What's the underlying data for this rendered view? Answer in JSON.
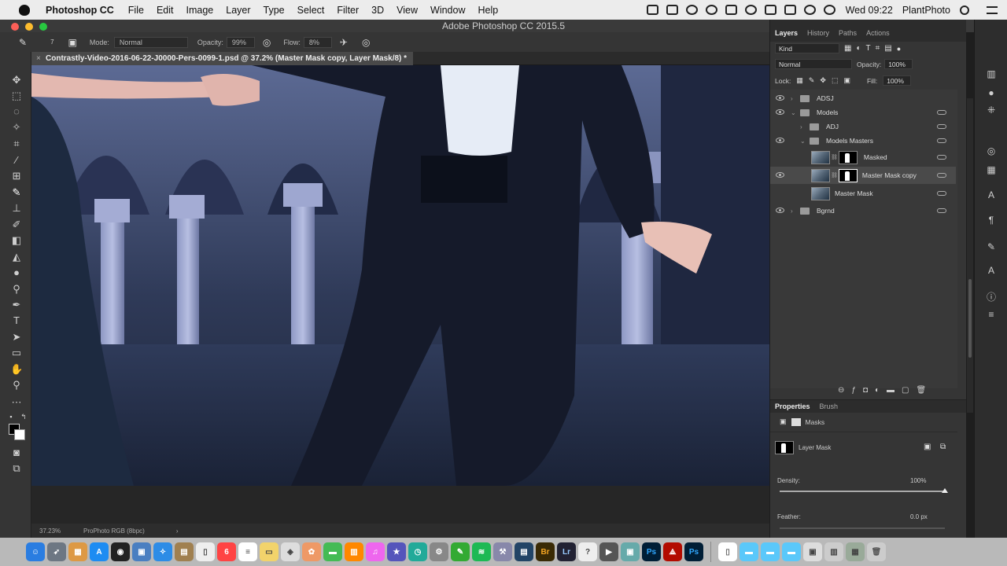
{
  "menubar": {
    "app_name": "Photoshop CC",
    "items": [
      "File",
      "Edit",
      "Image",
      "Layer",
      "Type",
      "Select",
      "Filter",
      "3D",
      "View",
      "Window",
      "Help"
    ],
    "clock": "Wed 09:22",
    "user": "PlantPhoto"
  },
  "window": {
    "title": "Adobe Photoshop CC 2015.5"
  },
  "options": {
    "mode_label": "Mode:",
    "mode_value": "Normal",
    "opacity_label": "Opacity:",
    "opacity_value": "99%",
    "flow_label": "Flow:",
    "flow_value": "8%",
    "brush_size": "7"
  },
  "document": {
    "tab_title": "Contrastly-Video-2016-06-22-J0000-Pers-0099-1.psd @ 37.2% (Master Mask copy, Layer Mask/8) *",
    "close_glyph": "×"
  },
  "status": {
    "zoom": "37.23%",
    "profile": "ProPhoto RGB (8bpc)",
    "arrow": "›"
  },
  "layers_panel": {
    "tabs": [
      "Layers",
      "History",
      "Paths",
      "Actions"
    ],
    "filter_label": "Kind",
    "blend_mode": "Normal",
    "opacity_label": "Opacity:",
    "opacity_value": "100%",
    "lock_label": "Lock:",
    "fill_label": "Fill:",
    "fill_value": "100%",
    "layers": [
      {
        "name": "ADSJ",
        "type": "group",
        "indent": 0,
        "visible": true,
        "expanded": false
      },
      {
        "name": "Models",
        "type": "group",
        "indent": 0,
        "visible": true,
        "expanded": true
      },
      {
        "name": "ADJ",
        "type": "group",
        "indent": 1,
        "visible": false,
        "expanded": false
      },
      {
        "name": "Models Masters",
        "type": "group",
        "indent": 1,
        "visible": true,
        "expanded": true
      },
      {
        "name": "Masked",
        "type": "masked",
        "indent": 2,
        "visible": false,
        "selected": false
      },
      {
        "name": "Master  Mask copy",
        "type": "masked",
        "indent": 2,
        "visible": true,
        "selected": true
      },
      {
        "name": "Master  Mask",
        "type": "pixel",
        "indent": 2,
        "visible": false,
        "selected": false
      },
      {
        "name": "Bgrnd",
        "type": "group",
        "indent": 0,
        "visible": true,
        "expanded": false
      }
    ]
  },
  "properties_panel": {
    "tabs": [
      "Properties",
      "Brush"
    ],
    "section": "Masks",
    "mask_label": "Layer Mask",
    "density_label": "Density:",
    "density_value": "100%",
    "density_level": 1.0,
    "feather_label": "Feather:",
    "feather_value": "0.0 px"
  },
  "dock": {
    "labeled_apps": [
      "Br",
      "Lr",
      "Ps",
      "Ps"
    ]
  },
  "colors": {
    "menubar_bg": "#ececec",
    "panel_bg": "#353535",
    "canvas_tint": "#243049",
    "dock_bg": "#b9b9b9"
  }
}
